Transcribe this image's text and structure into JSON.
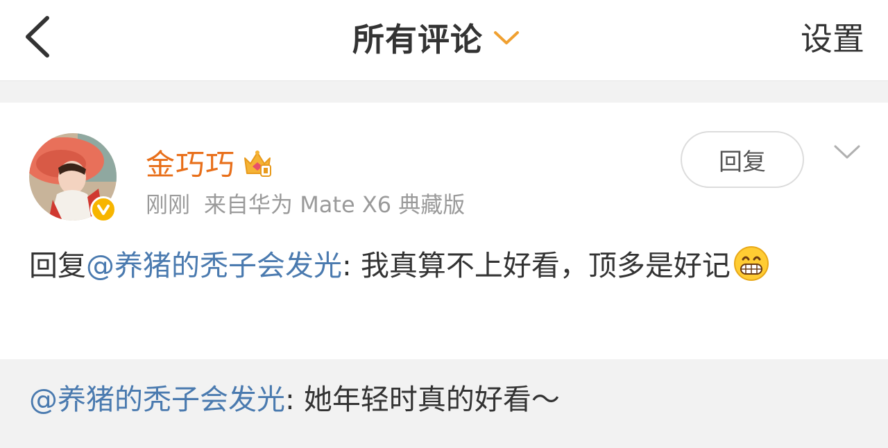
{
  "header": {
    "title": "所有评论",
    "settings_label": "设置"
  },
  "comment": {
    "username": "金巧巧",
    "time": "刚刚",
    "source": "来自华为 Mate X6 典藏版",
    "reply_button_label": "回复",
    "body_prefix": "回复",
    "mention": "@养猪的秃子会发光",
    "body_text": ": 我真算不上好看，顶多是好记",
    "emoji": "grinning-face-emoji"
  },
  "quoted": {
    "mention": "@养猪的秃子会发光",
    "text": ": 她年轻时真的好看～"
  },
  "colors": {
    "username": "#e86f1a",
    "mention": "#4a7aaf",
    "accent_chevron": "#f0a030",
    "verified": "#f7b500",
    "band": "#f2f2f2"
  }
}
